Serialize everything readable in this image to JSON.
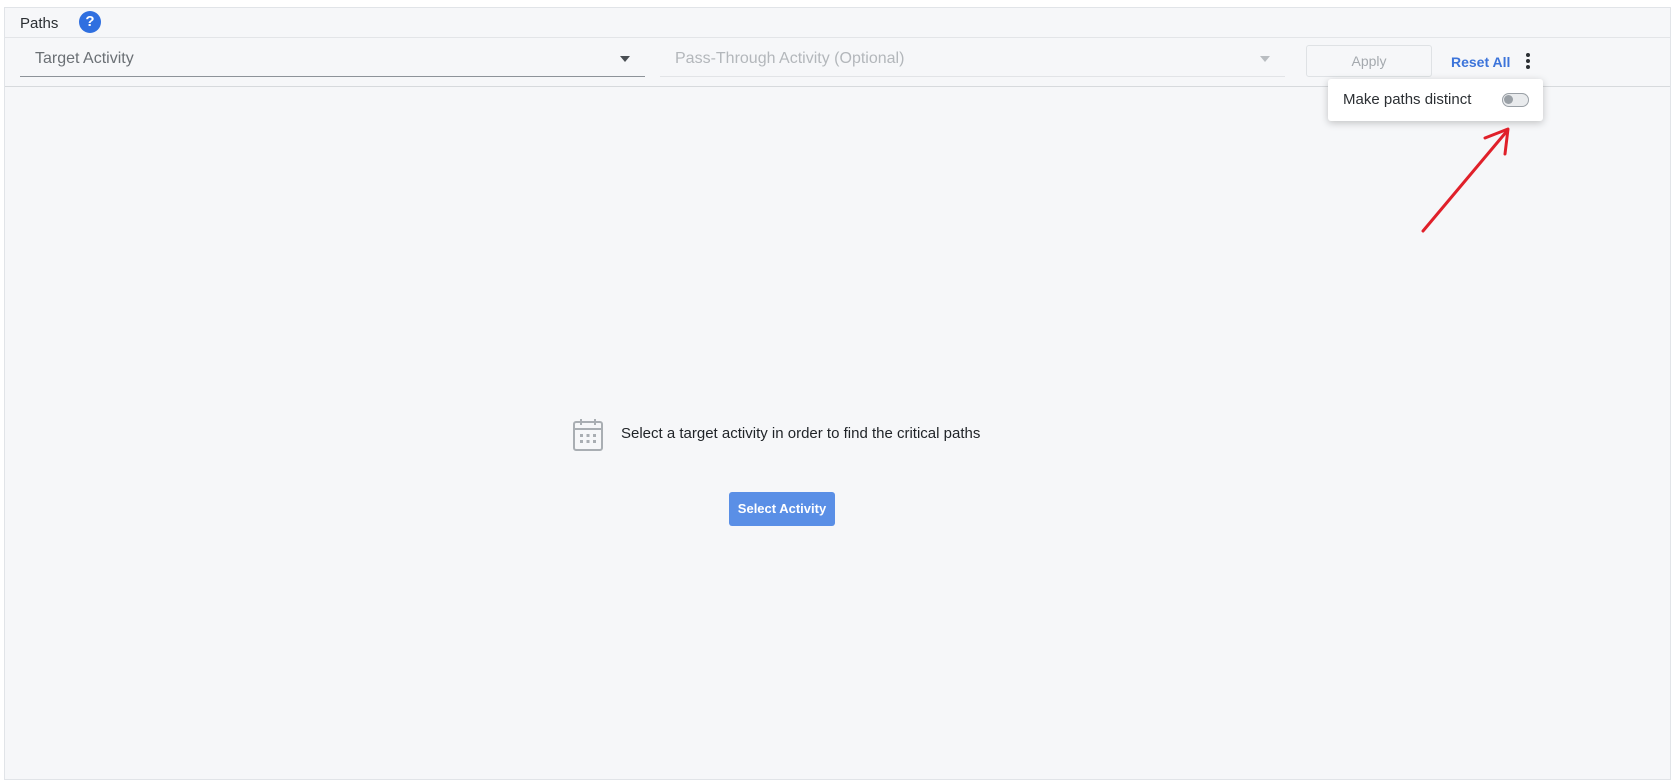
{
  "header": {
    "title": "Paths",
    "help_icon": "question-circle-icon",
    "help_glyph": "?"
  },
  "toolbar": {
    "target_activity_placeholder": "Target Activity",
    "pass_through_placeholder": "Pass-Through Activity (Optional)",
    "apply_label": "Apply",
    "reset_label": "Reset All",
    "more_icon": "vertical-ellipsis-icon"
  },
  "popover": {
    "option_label": "Make paths distinct",
    "toggle_state": "off"
  },
  "empty_state": {
    "icon": "calendar-icon",
    "message": "Select a target activity in order to find the critical paths",
    "button_label": "Select Activity"
  },
  "colors": {
    "accent": "#3c74da",
    "button": "#5a8fe6",
    "annotation_arrow": "#e0202a",
    "background": "#f6f7f9"
  }
}
